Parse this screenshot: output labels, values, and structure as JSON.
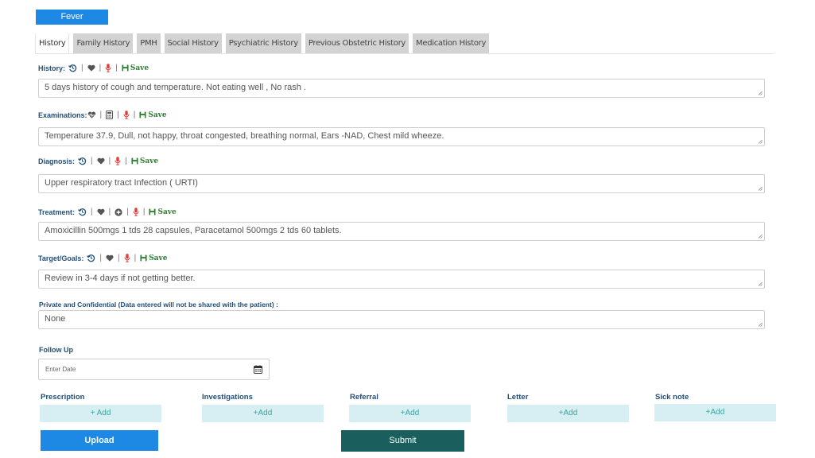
{
  "header": {
    "condition_tab": "Fever"
  },
  "tabs": [
    "History",
    "Family History",
    "PMH",
    "Social History",
    "Psychiatric History",
    "Previous Obstetric History",
    "Medication History"
  ],
  "common": {
    "save_label": "Save",
    "separator": "|"
  },
  "sections": {
    "history": {
      "label": "History:",
      "value": "5 days history of cough and temperature. Not eating well , No rash ."
    },
    "examinations": {
      "label": "Examinations:",
      "value": "Temperature 37.9, Dull, not happy, throat congested, breathing normal, Ears -NAD, Chest mild wheeze."
    },
    "diagnosis": {
      "label": "Diagnosis:",
      "value": "Upper respiratory tract Infection ( URTI)"
    },
    "treatment": {
      "label": "Treatment:",
      "value": "Amoxicillin 500mgs 1 tds 28 capsules, Paracetamol 500mgs 2 tds 60 tablets."
    },
    "goals": {
      "label": "Target/Goals:",
      "value": "Review in 3-4 days if not getting better."
    },
    "private": {
      "label": "Private and Confidential  (Data entered will not be shared with the patient) :",
      "value": "None"
    }
  },
  "follow_up": {
    "label": "Follow Up",
    "placeholder": "Enter Date"
  },
  "actions": [
    {
      "label": "Prescription",
      "button": "+ Add"
    },
    {
      "label": "Investigations",
      "button": "+Add"
    },
    {
      "label": "Referral",
      "button": "+Add"
    },
    {
      "label": "Letter",
      "button": "+Add"
    },
    {
      "label": "Sick note",
      "button": "+Add"
    }
  ],
  "buttons": {
    "upload": "Upload",
    "submit": "Submit"
  },
  "colors": {
    "primary": "#1e88e5",
    "submit": "#1b5e5e",
    "label": "#1f4e79",
    "save": "#2e7d32",
    "mic": "#e53935",
    "add_bg": "#d7eff2"
  }
}
